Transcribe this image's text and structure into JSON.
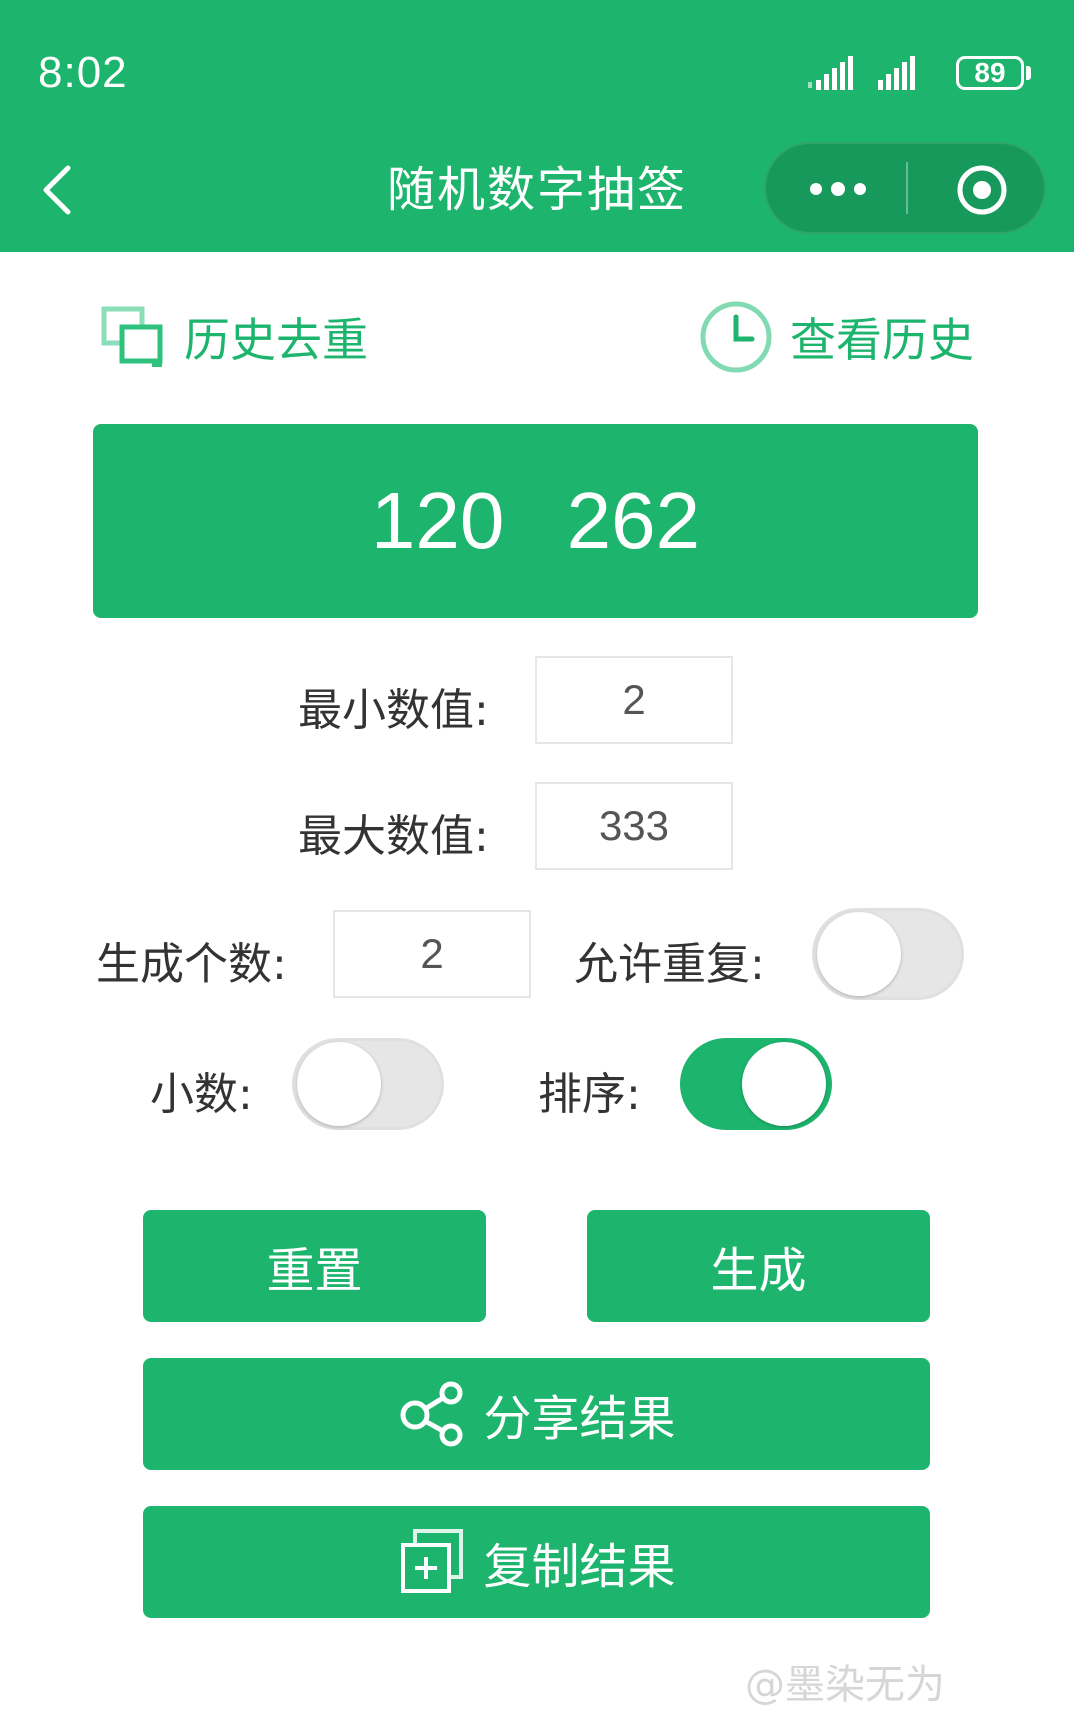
{
  "status_bar": {
    "time": "8:02",
    "battery": "89"
  },
  "nav": {
    "title": "随机数字抽签"
  },
  "top_links": {
    "dedupe_label": "历史去重",
    "history_label": "查看历史"
  },
  "result": {
    "text": "120 262"
  },
  "form": {
    "min_label": "最小数值:",
    "min_value": "2",
    "max_label": "最大数值:",
    "max_value": "333",
    "count_label": "生成个数:",
    "count_value": "2",
    "allow_repeat_label": "允许重复:",
    "allow_repeat": false,
    "decimal_label": "小数:",
    "decimal": false,
    "sort_label": "排序:",
    "sort": true
  },
  "buttons": {
    "reset": "重置",
    "generate": "生成",
    "share": "分享结果",
    "copy": "复制结果"
  },
  "watermark": "@墨染无为",
  "colors": {
    "primary": "#1db56d",
    "capsule": "#16995b"
  }
}
